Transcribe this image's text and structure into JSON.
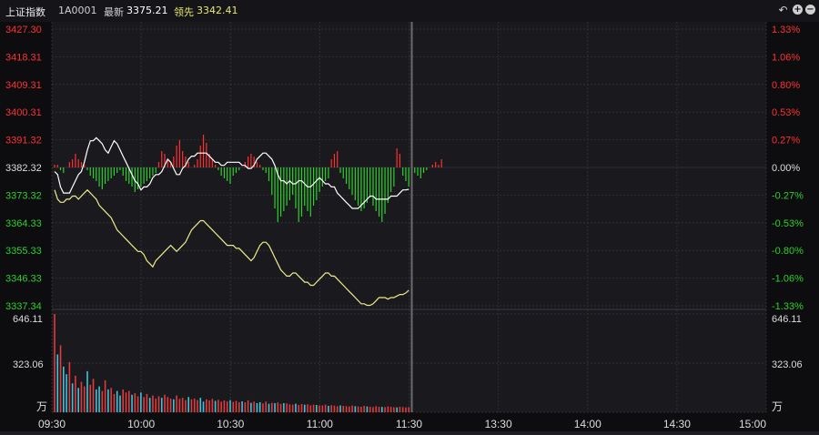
{
  "header": {
    "index_name": "上证指数",
    "code": "1A0001",
    "latest_label": "最新",
    "latest_value": "3375.21",
    "lead_label": "领先",
    "lead_value": "3342.41",
    "icons": [
      "undo-icon",
      "zoom-in-icon",
      "zoom-out-icon"
    ]
  },
  "colors": {
    "background": "#1a1a1e",
    "grid": "#2f2f35",
    "up": "#ff3030",
    "down": "#2bd12b",
    "neutral": "#dddddd",
    "index_line": "#ffffff",
    "lead_line": "#ecec8c",
    "volume_up": "#e23a3a",
    "volume_down": "#39c6de",
    "cursor": "#6a6a70",
    "lead_text": "#e8e86c"
  },
  "chart_data": [
    {
      "type": "line",
      "name": "intraday-price",
      "prev_close": 3382.32,
      "y_ticks": [
        "3427.30",
        "3418.31",
        "3409.31",
        "3400.31",
        "3391.32",
        "3382.32",
        "3373.32",
        "3364.33",
        "3355.33",
        "3346.33",
        "3337.34"
      ],
      "pct_ticks": [
        "1.33%",
        "1.06%",
        "0.80%",
        "0.53%",
        "0.27%",
        "0.00%",
        "-0.27%",
        "-0.53%",
        "-0.80%",
        "-1.06%",
        "-1.33%"
      ],
      "ylim": [
        3337.34,
        3427.3
      ],
      "x_ticks": [
        "09:30",
        "10:00",
        "10:30",
        "11:00",
        "11:30",
        "13:30",
        "14:00",
        "14:30",
        "15:00"
      ],
      "session_minutes": 240,
      "elapsed_minutes": 120,
      "series": [
        {
          "values": [
            3381,
            3380,
            3376,
            3374,
            3374,
            3374,
            3376,
            3378,
            3380,
            3381,
            3384,
            3388,
            3391,
            3391,
            3392,
            3391,
            3390,
            3388,
            3387,
            3389,
            3391,
            3390,
            3388,
            3386,
            3384,
            3382,
            3380,
            3378,
            3377,
            3375,
            3376,
            3376,
            3377,
            3379,
            3380,
            3380,
            3381,
            3383,
            3385,
            3384,
            3382,
            3380,
            3380,
            3382,
            3383,
            3385,
            3386,
            3386,
            3387,
            3387,
            3387,
            3387,
            3386,
            3385,
            3384,
            3384,
            3383,
            3383,
            3384,
            3384,
            3384,
            3384,
            3384,
            3383,
            3383,
            3382,
            3382,
            3383,
            3385,
            3386,
            3387,
            3387,
            3386,
            3385,
            3383,
            3380,
            3378,
            3378,
            3377,
            3378,
            3377,
            3377,
            3378,
            3378,
            3377,
            3376,
            3376,
            3377,
            3378,
            3379,
            3378,
            3377,
            3377,
            3376,
            3376,
            3374,
            3373,
            3372,
            3371,
            3370,
            3369,
            3369,
            3369,
            3370,
            3371,
            3372,
            3373,
            3373,
            3372,
            3372,
            3372,
            3372,
            3372,
            3373,
            3373,
            3373,
            3374,
            3375,
            3375,
            3375.21
          ]
        },
        {
          "values": [
            3375,
            3372,
            3371,
            3371,
            3372,
            3372,
            3373,
            3373,
            3372,
            3373,
            3374,
            3375,
            3374,
            3373,
            3372,
            3370,
            3369,
            3368,
            3367,
            3366,
            3364,
            3362,
            3361,
            3360,
            3359,
            3358,
            3357,
            3356,
            3355,
            3355,
            3354,
            3352,
            3351,
            3350,
            3352,
            3353,
            3354,
            3355,
            3356,
            3357,
            3356,
            3355,
            3356,
            3357,
            3358,
            3360,
            3362,
            3363,
            3364,
            3365,
            3365,
            3364,
            3363,
            3362,
            3361,
            3360,
            3359,
            3358,
            3357,
            3357,
            3357,
            3356,
            3356,
            3355,
            3354,
            3353,
            3352,
            3353,
            3355,
            3357,
            3358,
            3358,
            3357,
            3355,
            3353,
            3351,
            3349,
            3348,
            3347,
            3347,
            3348,
            3348,
            3347,
            3346,
            3345,
            3345,
            3344,
            3344,
            3345,
            3346,
            3347,
            3348,
            3348,
            3347,
            3347,
            3346,
            3345,
            3344,
            3343,
            3342,
            3341,
            3340,
            3339,
            3338,
            3338,
            3337.5,
            3337.5,
            3338,
            3339,
            3340,
            3340,
            3340,
            3339.5,
            3340,
            3340,
            3340.5,
            3341,
            3341,
            3341.5,
            3342.41
          ]
        }
      ]
    },
    {
      "type": "bar",
      "name": "buy-sell-strength",
      "values": [
        1,
        1,
        -1,
        -2,
        0,
        2,
        3,
        5,
        3,
        2,
        1,
        -1,
        -3,
        -4,
        -5,
        -7,
        -8,
        -6,
        -5,
        -4,
        -3,
        -2,
        -1,
        -3,
        -5,
        -6,
        -7,
        -9,
        -8,
        -7,
        -6,
        -5,
        -4,
        -3,
        -2,
        2,
        6,
        5,
        3,
        2,
        4,
        8,
        10,
        6,
        4,
        2,
        0,
        1,
        3,
        8,
        12,
        9,
        5,
        3,
        1,
        -1,
        -3,
        -4,
        -5,
        -6,
        -3,
        -2,
        -1,
        0,
        2,
        4,
        5,
        4,
        2,
        1,
        -1,
        -2,
        -5,
        -10,
        -15,
        -20,
        -18,
        -16,
        -14,
        -12,
        -10,
        -15,
        -20,
        -18,
        -14,
        -16,
        -18,
        -14,
        -12,
        -9,
        -7,
        -5,
        -4,
        3,
        5,
        6,
        -2,
        -4,
        -6,
        -8,
        -10,
        -12,
        -14,
        -16,
        -15,
        -13,
        -11,
        -14,
        -16,
        -18,
        -20,
        -17,
        -13,
        -9,
        -7,
        7,
        5,
        -3,
        -5,
        -7,
        -4,
        -2,
        -3,
        -4,
        -2,
        -1,
        0,
        1,
        2,
        1,
        3
      ],
      "ylim": [
        -20,
        20
      ]
    },
    {
      "type": "bar",
      "name": "volume",
      "y_ticks": [
        "646.11",
        "323.06"
      ],
      "unit": "万",
      "ylim": [
        0,
        646.11
      ],
      "values": [
        646,
        380,
        440,
        300,
        250,
        330,
        190,
        240,
        160,
        200,
        170,
        270,
        180,
        220,
        150,
        170,
        140,
        210,
        150,
        160,
        120,
        140,
        110,
        150,
        130,
        140,
        115,
        125,
        105,
        130,
        100,
        120,
        95,
        110,
        90,
        105,
        95,
        115,
        100,
        90,
        85,
        110,
        88,
        95,
        80,
        100,
        85,
        90,
        80,
        95,
        70,
        85,
        78,
        88,
        75,
        82,
        70,
        78,
        72,
        80,
        68,
        75,
        66,
        72,
        65,
        78,
        62,
        70,
        60,
        66,
        58,
        70,
        56,
        62,
        60,
        64,
        55,
        60,
        58,
        52,
        50,
        56,
        48,
        54,
        50,
        52,
        46,
        50,
        48,
        44,
        45,
        50,
        42,
        46,
        44,
        40,
        45,
        42,
        40,
        38,
        44,
        40,
        38,
        36,
        42,
        38,
        36,
        34,
        40,
        36,
        35,
        34,
        38,
        35,
        33,
        32,
        36,
        34,
        32,
        34
      ],
      "directions": [
        1,
        0,
        1,
        0,
        0,
        1,
        0,
        1,
        0,
        1,
        1,
        0,
        1,
        1,
        0,
        0,
        1,
        1,
        0,
        1,
        1,
        0,
        0,
        1,
        1,
        1,
        0,
        1,
        1,
        0,
        1,
        1,
        0,
        1,
        1,
        1,
        0,
        1,
        1,
        1,
        0,
        1,
        1,
        1,
        1,
        0,
        1,
        1,
        1,
        0,
        0,
        1,
        1,
        1,
        0,
        1,
        1,
        1,
        1,
        0,
        1,
        1,
        1,
        0,
        1,
        1,
        0,
        1,
        0,
        0,
        1,
        1,
        0,
        1,
        0,
        1,
        1,
        0,
        1,
        1,
        1,
        0,
        1,
        1,
        0,
        1,
        1,
        1,
        0,
        1,
        1,
        1,
        0,
        1,
        1,
        1,
        0,
        1,
        1,
        1,
        1,
        0,
        1,
        1,
        1,
        0,
        1,
        1,
        1,
        1,
        0,
        1,
        1,
        1,
        1,
        0,
        1,
        1,
        1,
        1
      ]
    }
  ]
}
